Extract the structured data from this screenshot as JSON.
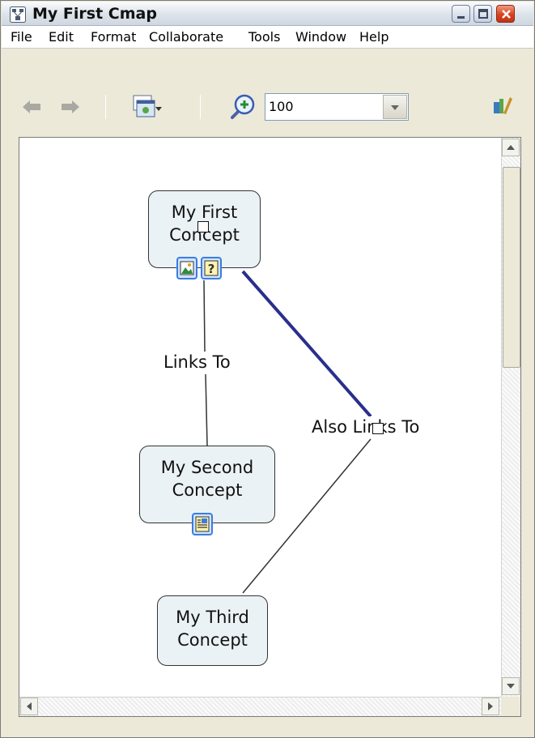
{
  "window": {
    "title": "My First Cmap"
  },
  "menubar": {
    "items": [
      "File",
      "Edit",
      "Format",
      "Collaborate",
      "Tools",
      "Window",
      "Help"
    ]
  },
  "toolbar": {
    "back_icon": "back-arrow-icon",
    "forward_icon": "forward-arrow-icon",
    "view_icon": "view-options-icon",
    "zoom_icon": "zoom-in-icon",
    "zoom_value": "100",
    "edit_icon": "cmap-style-icon"
  },
  "cmap": {
    "concepts": [
      {
        "id": "first",
        "lines": [
          "My First",
          "Concept"
        ],
        "resources": [
          "image-resource-icon",
          "help-resource-icon"
        ]
      },
      {
        "id": "second",
        "lines": [
          "My Second",
          "Concept"
        ],
        "resources": [
          "document-resource-icon"
        ]
      },
      {
        "id": "third",
        "lines": [
          "My Third",
          "Concept"
        ],
        "resources": []
      }
    ],
    "links": [
      {
        "label": "Links To"
      },
      {
        "label": "Also Links To"
      }
    ],
    "colors": {
      "concept_fill": "#ebf2f5",
      "selected_link": "#2a2f8c",
      "link": "#333333"
    }
  }
}
